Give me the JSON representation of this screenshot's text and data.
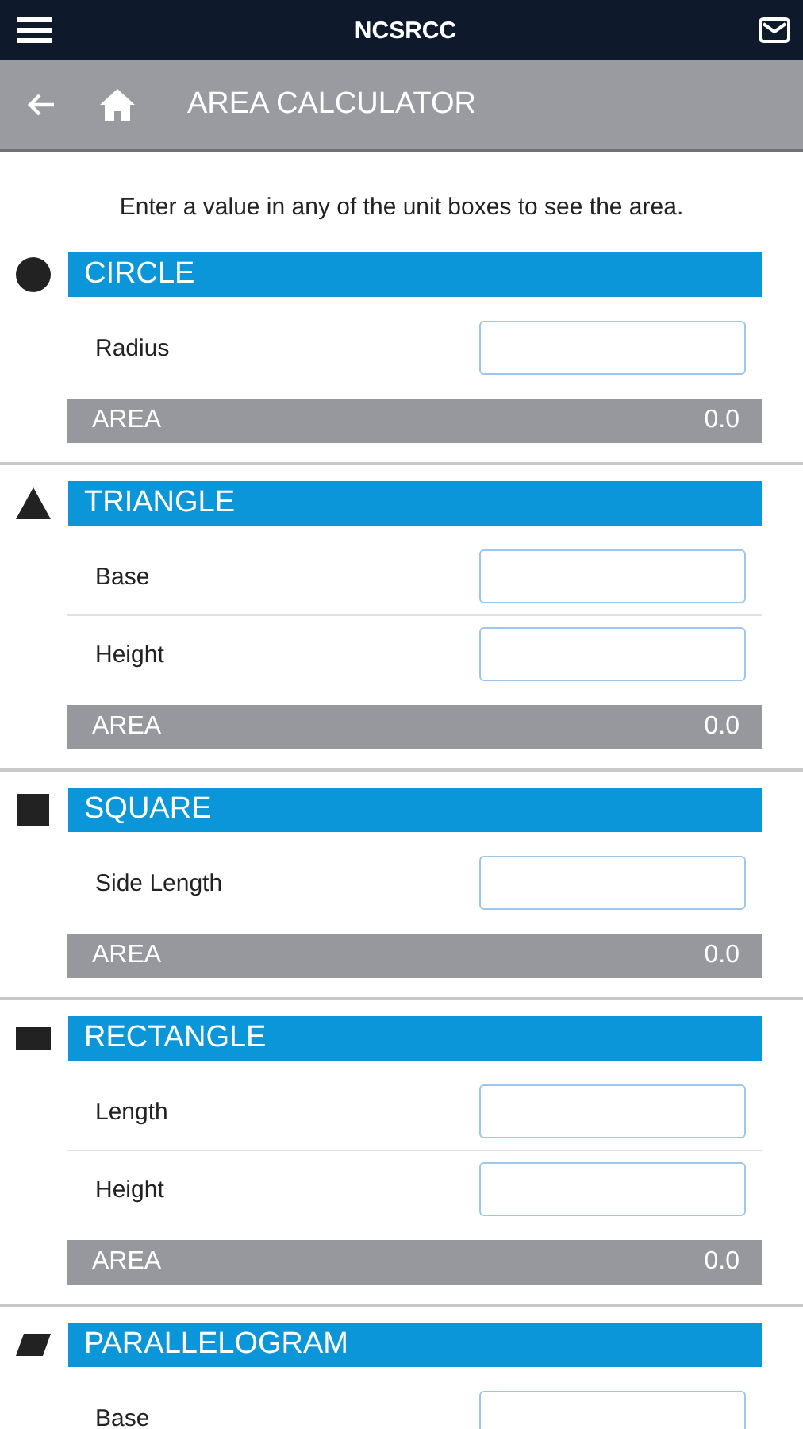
{
  "app_bar": {
    "title": "NCSRCC"
  },
  "page_header": {
    "title": "AREA CALCULATOR"
  },
  "intro": "Enter a value in any of the unit boxes to see the area.",
  "shapes": [
    {
      "kind": "circle",
      "title": "CIRCLE",
      "fields": [
        {
          "label": "Radius"
        }
      ],
      "area_label": "AREA",
      "area_value": "0.0"
    },
    {
      "kind": "triangle",
      "title": "TRIANGLE",
      "fields": [
        {
          "label": "Base"
        },
        {
          "label": "Height"
        }
      ],
      "area_label": "AREA",
      "area_value": "0.0"
    },
    {
      "kind": "square",
      "title": "SQUARE",
      "fields": [
        {
          "label": "Side Length"
        }
      ],
      "area_label": "AREA",
      "area_value": "0.0"
    },
    {
      "kind": "rectangle",
      "title": "RECTANGLE",
      "fields": [
        {
          "label": "Length"
        },
        {
          "label": "Height"
        }
      ],
      "area_label": "AREA",
      "area_value": "0.0"
    },
    {
      "kind": "parallelogram",
      "title": "PARALLELOGRAM",
      "fields": [
        {
          "label": "Base"
        }
      ]
    }
  ]
}
